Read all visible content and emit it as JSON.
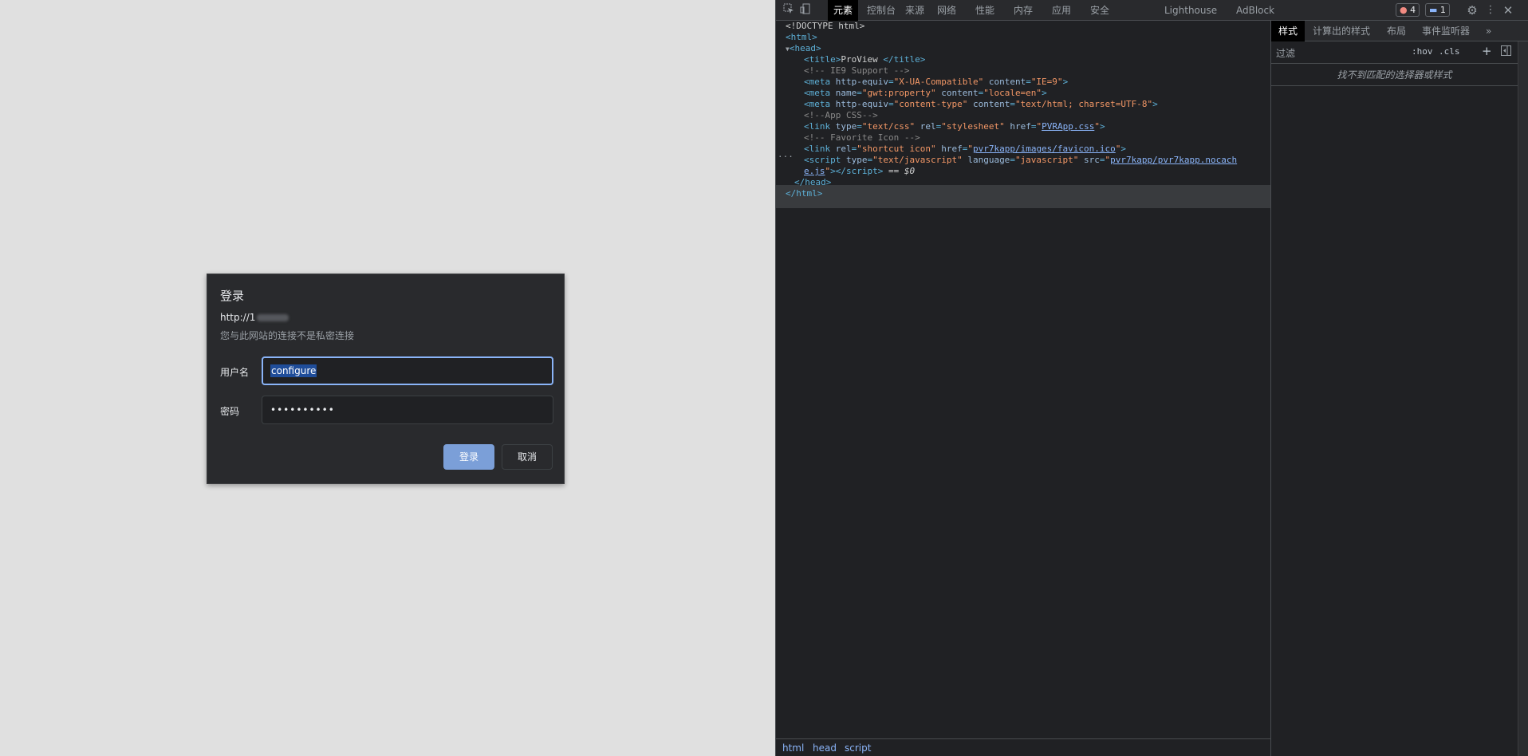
{
  "dialog": {
    "title": "登录",
    "url_prefix": "http://1",
    "warning": "您与此网站的连接不是私密连接",
    "username_label": "用户名",
    "username_value": "configure",
    "password_label": "密码",
    "password_value": "••••••••••",
    "login_button": "登录",
    "cancel_button": "取消"
  },
  "devtools": {
    "tabs": [
      "元素",
      "控制台",
      "来源",
      "网络",
      "性能",
      "内存",
      "应用",
      "安全",
      "Lighthouse",
      "AdBlock"
    ],
    "active_tab": "元素",
    "error_count": "4",
    "message_count": "1",
    "dom": {
      "doctype": "<!DOCTYPE html>",
      "html_open": "<html>",
      "head_open": "<head>",
      "title_text": "ProView ",
      "ie9_comment": "<!-- IE9 Support -->",
      "meta1_attr": "http-equiv",
      "meta1_val": "\"X-UA-Compatible\"",
      "meta1_attr2": "content",
      "meta1_val2": "\"IE=9\"",
      "meta2_attr": "name",
      "meta2_val": "\"gwt:property\"",
      "meta2_attr2": "content",
      "meta2_val2": "\"locale=en\"",
      "meta3_attr": "http-equiv",
      "meta3_val": "\"content-type\"",
      "meta3_attr2": "content",
      "meta3_val2": "\"text/html; charset=UTF-8\"",
      "appcss_comment": "<!--App CSS-->",
      "link1_type": "\"text/css\"",
      "link1_rel": "\"stylesheet\"",
      "link1_href": "PVRApp.css",
      "fav_comment": "<!-- Favorite Icon -->",
      "link2_rel": "\"shortcut icon\"",
      "link2_href": "pvr7kapp/images/favicon.ico",
      "script_type": "\"text/javascript\"",
      "script_lang": "\"javascript\"",
      "script_src_1": "pvr7kapp/pvr7kapp.nocach",
      "script_src_2": "e.js",
      "script_tail": " == $0",
      "head_close": "</head>",
      "html_close": "</html>"
    },
    "breadcrumbs": [
      "html",
      "head",
      "script"
    ],
    "styles_tabs": [
      "样式",
      "计算出的样式",
      "布局",
      "事件监听器"
    ],
    "filter_placeholder": "过滤",
    "hov": ":hov",
    "cls": ".cls",
    "no_match": "找不到匹配的选择器或样式"
  }
}
